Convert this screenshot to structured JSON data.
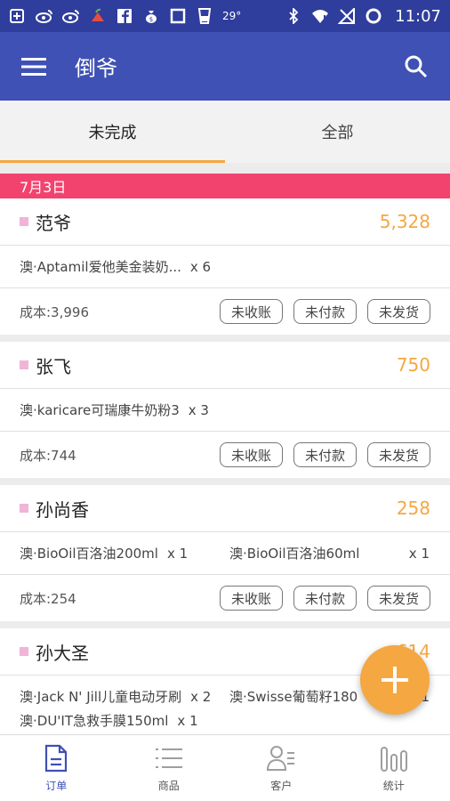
{
  "status_bar": {
    "temperature": "29°",
    "time": "11:07",
    "icons": [
      "add-box-icon",
      "weibo-icon",
      "weibo-icon",
      "fruit-icon",
      "facebook-icon",
      "money-bag-icon",
      "square-icon",
      "glass-icon",
      "bluetooth-icon",
      "wifi-icon",
      "no-signal-icon",
      "battery-icon"
    ]
  },
  "app_bar": {
    "title": "倒爷"
  },
  "tabs": [
    {
      "label": "未完成",
      "active": true
    },
    {
      "label": "全部",
      "active": false
    }
  ],
  "date_header": "7月3日",
  "orders": [
    {
      "customer": "范爷",
      "amount": "5,328",
      "items": [
        {
          "name": "澳·Aptamil爱他美金装奶...",
          "qty": "x 6"
        }
      ],
      "cost": "成本:3,996",
      "statuses": [
        "未收账",
        "未付款",
        "未发货"
      ]
    },
    {
      "customer": "张飞",
      "amount": "750",
      "items": [
        {
          "name": "澳·karicare可瑞康牛奶粉3",
          "qty": "x 3"
        }
      ],
      "cost": "成本:744",
      "statuses": [
        "未收账",
        "未付款",
        "未发货"
      ]
    },
    {
      "customer": "孙尚香",
      "amount": "258",
      "items": [
        {
          "name": "澳·BioOil百洛油200ml",
          "qty": "x 1"
        },
        {
          "name": "澳·BioOil百洛油60ml",
          "qty": "x 1"
        }
      ],
      "cost": "成本:254",
      "statuses": [
        "未收账",
        "未付款",
        "未发货"
      ]
    },
    {
      "customer": "孙大圣",
      "amount": "614",
      "items": [
        {
          "name": "澳·Jack N' Jill儿童电动牙刷",
          "qty": "x 2"
        },
        {
          "name": "澳·Swisse葡萄籽180",
          "qty": "x 1"
        },
        {
          "name": "澳·DU'IT急救手膜150ml",
          "qty": "x 1"
        }
      ]
    }
  ],
  "bottom_nav": [
    {
      "label": "订单",
      "icon": "document-icon",
      "active": true
    },
    {
      "label": "商品",
      "icon": "list-icon",
      "active": false
    },
    {
      "label": "客户",
      "icon": "contacts-icon",
      "active": false
    },
    {
      "label": "统计",
      "icon": "bar-chart-icon",
      "active": false
    }
  ],
  "colors": {
    "status_bar": "#2f3d9c",
    "app_bar": "#3f51b5",
    "accent": "#f5a742",
    "date_bar": "#f2436f",
    "marker": "#f2b3d8"
  }
}
